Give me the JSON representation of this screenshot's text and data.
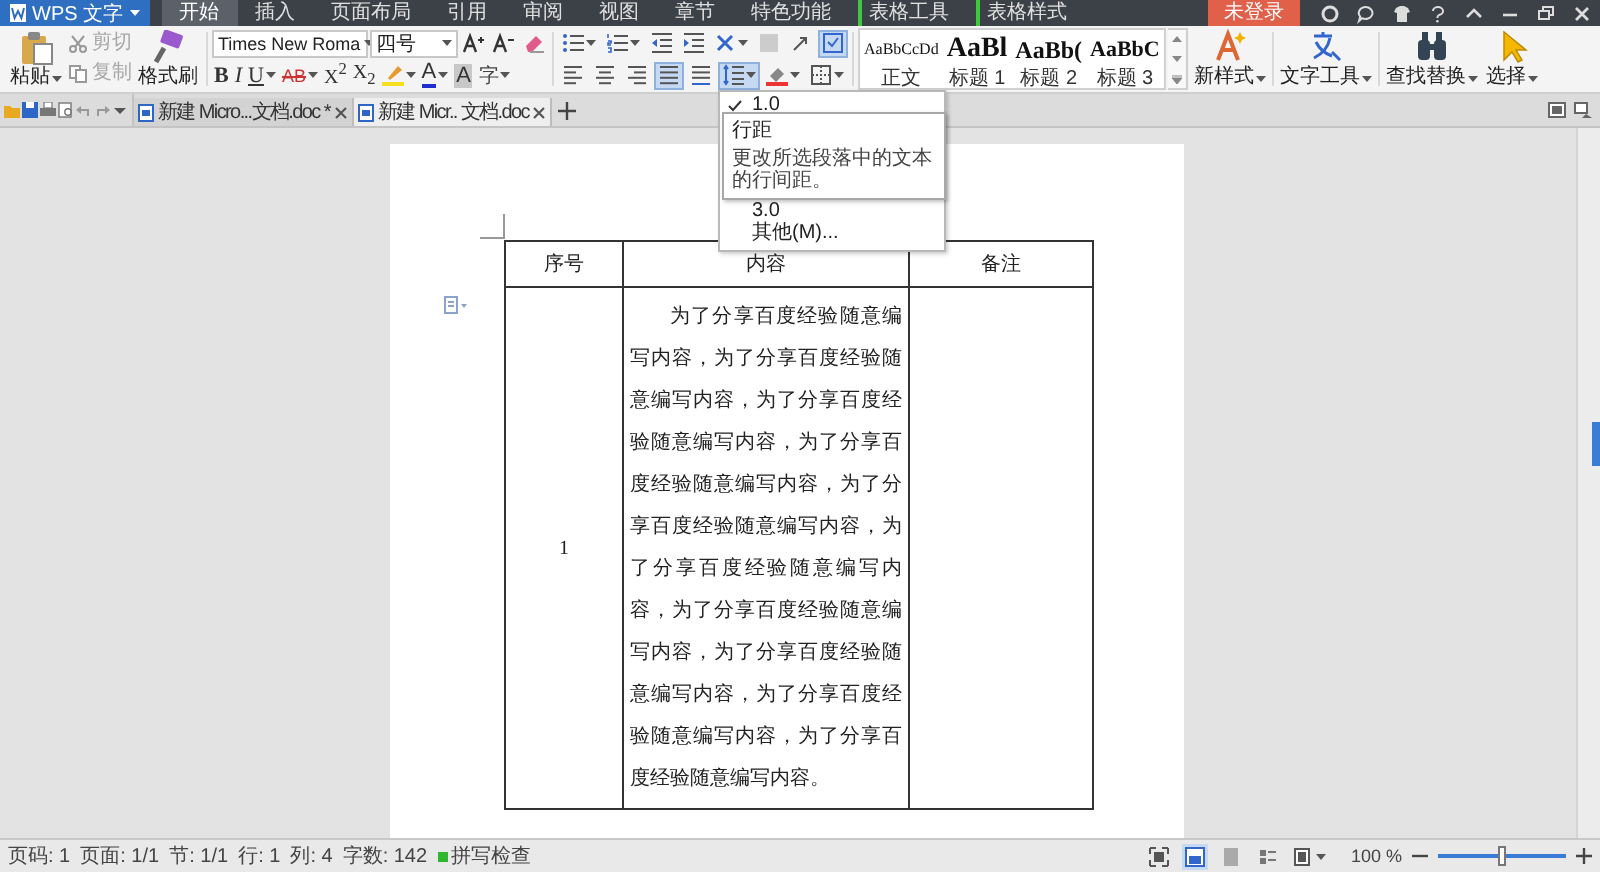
{
  "app_button": {
    "label": "WPS 文字"
  },
  "menu_tabs": [
    {
      "label": "开始",
      "selected": true,
      "kind": "main"
    },
    {
      "label": "插入",
      "selected": false,
      "kind": "main"
    },
    {
      "label": "页面布局",
      "selected": false,
      "kind": "main"
    },
    {
      "label": "引用",
      "selected": false,
      "kind": "main"
    },
    {
      "label": "审阅",
      "selected": false,
      "kind": "main"
    },
    {
      "label": "视图",
      "selected": false,
      "kind": "main"
    },
    {
      "label": "章节",
      "selected": false,
      "kind": "main"
    },
    {
      "label": "特色功能",
      "selected": false,
      "kind": "main"
    },
    {
      "label": "表格工具",
      "selected": false,
      "kind": "context"
    },
    {
      "label": "表格样式",
      "selected": false,
      "kind": "context"
    }
  ],
  "login_button": "未登录",
  "clipboard": {
    "paste": "粘贴",
    "cut": {
      "label": "剪切",
      "disabled": true
    },
    "copy": {
      "label": "复制",
      "disabled": true
    },
    "format_painter": "格式刷"
  },
  "font": {
    "name": "Times New Roma",
    "size": "四号",
    "buttons": [
      {
        "kind": "bold",
        "label": "B",
        "dropdown": false
      },
      {
        "kind": "italic",
        "label": "I",
        "dropdown": false
      },
      {
        "kind": "underline",
        "label": "U",
        "dropdown": true
      },
      {
        "kind": "strike",
        "label": "AB",
        "dropdown": true
      },
      {
        "kind": "sup",
        "label": "X$^{2}$",
        "dropdown": false
      },
      {
        "kind": "sub",
        "label": "X$_{2}$",
        "dropdown": false
      },
      {
        "kind": "highlight",
        "dropdown": true
      },
      {
        "kind": "color",
        "label": "A",
        "dropdown": true
      },
      {
        "kind": "shade",
        "label": "A",
        "dropdown": false
      },
      {
        "kind": "phonetic",
        "label": "字",
        "dropdown": true
      }
    ]
  },
  "paragraph": {
    "top_buttons": [
      {
        "selected": false
      },
      {
        "selected": false
      },
      {
        "selected": false
      },
      {
        "selected": false
      },
      {
        "selected": false
      },
      {
        "selected": false
      },
      {
        "selected": false
      },
      {
        "selected": true
      }
    ],
    "bottom_buttons": [
      {
        "selected": false
      },
      {
        "selected": false
      },
      {
        "selected": false
      },
      {
        "selected": true
      },
      {
        "selected": false
      },
      {
        "selected": true
      },
      {
        "selected": false
      },
      {
        "selected": false
      }
    ]
  },
  "styles": [
    {
      "kind": "normal",
      "preview": "AaBbCcDd",
      "label": "正文"
    },
    {
      "kind": "h1",
      "preview": "AaBl",
      "label": "标题 1"
    },
    {
      "kind": "h2",
      "preview": "AaBb(",
      "label": "标题 2"
    },
    {
      "kind": "h3",
      "preview": "AaBbC",
      "label": "标题 3"
    }
  ],
  "tools": [
    {
      "kind": "new_style",
      "label": "新样式"
    },
    {
      "kind": "text_tools",
      "label": "文字工具"
    },
    {
      "kind": "find",
      "label": "查找替换"
    },
    {
      "kind": "select",
      "label": "选择"
    }
  ],
  "doc_tabs": [
    {
      "label": "新建 Micro...文档.doc *",
      "selected": false
    },
    {
      "label": "新建 Micr.. 文档.doc",
      "selected": true
    }
  ],
  "line_spacing_menu": {
    "items": [
      {
        "label": "1.0",
        "checked": true
      },
      {
        "label": "3.0",
        "checked": false
      },
      {
        "label": "其他(M)...",
        "checked": false
      }
    ],
    "tooltip": {
      "title": "行距",
      "text": "更改所选段落中的文本的行间距。"
    }
  },
  "table": {
    "columns": [
      "序号",
      "内容",
      "备注"
    ],
    "rows": [
      {
        "number": "1",
        "content": "为了分享百度经验随意编写内容，为了分享百度经验随意编写内容，为了分享百度经验随意编写内容，为了分享百度经验随意编写内容，为了分享百度经验随意编写内容，为了分享百度经验随意编写内容，为了分享百度经验随意编写内容，为了分享百度经验随意编写内容，为了分享百度经验随意编写内容，为了分享百度经验随意编写内容。"
      }
    ]
  },
  "status_bar": {
    "items": [
      "页码: 1",
      "页面: 1/1",
      "节: 1/1",
      "行: 1",
      "列: 4",
      "字数: 142"
    ],
    "spell_check": {
      "label": "拼写检查",
      "on": true
    },
    "zoom": {
      "label": "100 %",
      "level": 0.5
    }
  }
}
